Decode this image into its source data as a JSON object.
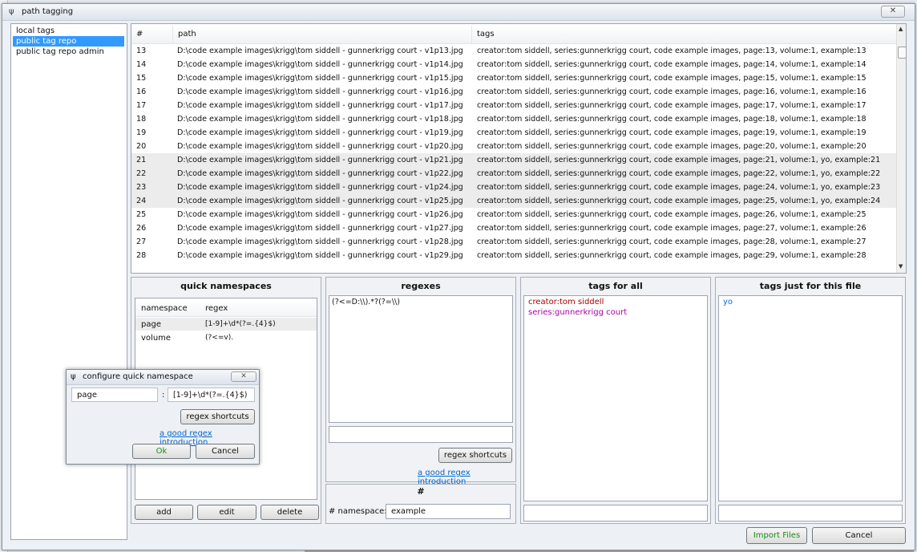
{
  "window": {
    "title": "path tagging",
    "close_glyph": "✕"
  },
  "sidebar": {
    "items": [
      {
        "label": "local tags"
      },
      {
        "label": "public tag repo"
      },
      {
        "label": "public tag repo admin"
      }
    ]
  },
  "table": {
    "headers": [
      "#",
      "path",
      "tags"
    ],
    "rows": [
      {
        "num": "13",
        "path": "D:\\code example images\\krigg\\tom siddell - gunnerkrigg court - v1p13.jpg",
        "tags": "creator:tom siddell, series:gunnerkrigg court, code example images, page:13, volume:1, example:13"
      },
      {
        "num": "14",
        "path": "D:\\code example images\\krigg\\tom siddell - gunnerkrigg court - v1p14.jpg",
        "tags": "creator:tom siddell, series:gunnerkrigg court, code example images, page:14, volume:1, example:14"
      },
      {
        "num": "15",
        "path": "D:\\code example images\\krigg\\tom siddell - gunnerkrigg court - v1p15.jpg",
        "tags": "creator:tom siddell, series:gunnerkrigg court, code example images, page:15, volume:1, example:15"
      },
      {
        "num": "16",
        "path": "D:\\code example images\\krigg\\tom siddell - gunnerkrigg court - v1p16.jpg",
        "tags": "creator:tom siddell, series:gunnerkrigg court, code example images, page:16, volume:1, example:16"
      },
      {
        "num": "17",
        "path": "D:\\code example images\\krigg\\tom siddell - gunnerkrigg court - v1p17.jpg",
        "tags": "creator:tom siddell, series:gunnerkrigg court, code example images, page:17, volume:1, example:17"
      },
      {
        "num": "18",
        "path": "D:\\code example images\\krigg\\tom siddell - gunnerkrigg court - v1p18.jpg",
        "tags": "creator:tom siddell, series:gunnerkrigg court, code example images, page:18, volume:1, example:18"
      },
      {
        "num": "19",
        "path": "D:\\code example images\\krigg\\tom siddell - gunnerkrigg court - v1p19.jpg",
        "tags": "creator:tom siddell, series:gunnerkrigg court, code example images, page:19, volume:1, example:19"
      },
      {
        "num": "20",
        "path": "D:\\code example images\\krigg\\tom siddell - gunnerkrigg court - v1p20.jpg",
        "tags": "creator:tom siddell, series:gunnerkrigg court, code example images, page:20, volume:1, example:20"
      },
      {
        "num": "21",
        "path": "D:\\code example images\\krigg\\tom siddell - gunnerkrigg court - v1p21.jpg",
        "tags": "creator:tom siddell, series:gunnerkrigg court, code example images, page:21, volume:1, yo, example:21"
      },
      {
        "num": "22",
        "path": "D:\\code example images\\krigg\\tom siddell - gunnerkrigg court - v1p22.jpg",
        "tags": "creator:tom siddell, series:gunnerkrigg court, code example images, page:22, volume:1, yo, example:22"
      },
      {
        "num": "23",
        "path": "D:\\code example images\\krigg\\tom siddell - gunnerkrigg court - v1p24.jpg",
        "tags": "creator:tom siddell, series:gunnerkrigg court, code example images, page:24, volume:1, yo, example:23"
      },
      {
        "num": "24",
        "path": "D:\\code example images\\krigg\\tom siddell - gunnerkrigg court - v1p25.jpg",
        "tags": "creator:tom siddell, series:gunnerkrigg court, code example images, page:25, volume:1, yo, example:24"
      },
      {
        "num": "25",
        "path": "D:\\code example images\\krigg\\tom siddell - gunnerkrigg court - v1p26.jpg",
        "tags": "creator:tom siddell, series:gunnerkrigg court, code example images, page:26, volume:1, example:25"
      },
      {
        "num": "26",
        "path": "D:\\code example images\\krigg\\tom siddell - gunnerkrigg court - v1p27.jpg",
        "tags": "creator:tom siddell, series:gunnerkrigg court, code example images, page:27, volume:1, example:26"
      },
      {
        "num": "27",
        "path": "D:\\code example images\\krigg\\tom siddell - gunnerkrigg court - v1p28.jpg",
        "tags": "creator:tom siddell, series:gunnerkrigg court, code example images, page:28, volume:1, example:27"
      },
      {
        "num": "28",
        "path": "D:\\code example images\\krigg\\tom siddell - gunnerkrigg court - v1p29.jpg",
        "tags": "creator:tom siddell, series:gunnerkrigg court, code example images, page:29, volume:1, example:28"
      }
    ]
  },
  "quick_namespaces": {
    "title": "quick namespaces",
    "headers": [
      "namespace",
      "regex"
    ],
    "rows": [
      {
        "namespace": "page",
        "regex": "[1-9]+\\d*(?=.{4}$)"
      },
      {
        "namespace": "volume",
        "regex": "(?<=v)."
      }
    ],
    "add_label": "add",
    "edit_label": "edit",
    "delete_label": "delete"
  },
  "regexes": {
    "title": "regexes",
    "value": "(?<=D:\\\\).*?(?=\\\\)",
    "shortcuts_label": "regex shortcuts",
    "intro_link": "a good regex introduction"
  },
  "hash_panel": {
    "title": "#",
    "label": "# namespace:",
    "value": "example"
  },
  "tags_for_all": {
    "title": "tags for all",
    "tags": [
      {
        "text": "creator:tom siddell",
        "color": "#aa0000"
      },
      {
        "text": "series:gunnerkrigg court",
        "color": "#aa00aa"
      }
    ]
  },
  "tags_this_file": {
    "title": "tags just for this file",
    "tags": [
      {
        "text": "yo",
        "color": "#006ffa"
      }
    ]
  },
  "footer": {
    "import_label": "Import Files",
    "cancel_label": "Cancel"
  },
  "dialog": {
    "title": "configure quick namespace",
    "namespace_value": "page",
    "separator": ":",
    "regex_value": "[1-9]+\\d*(?=.{4}$)",
    "shortcuts_label": "regex shortcuts",
    "intro_link": "a good regex introduction",
    "ok_label": "Ok",
    "cancel_label": "Cancel",
    "close_glyph": "✕"
  },
  "colors": {
    "selection": "#3399ff",
    "link": "#0066cc",
    "ok_text": "#1a8a1a",
    "import_text": "#1a8a1a"
  }
}
